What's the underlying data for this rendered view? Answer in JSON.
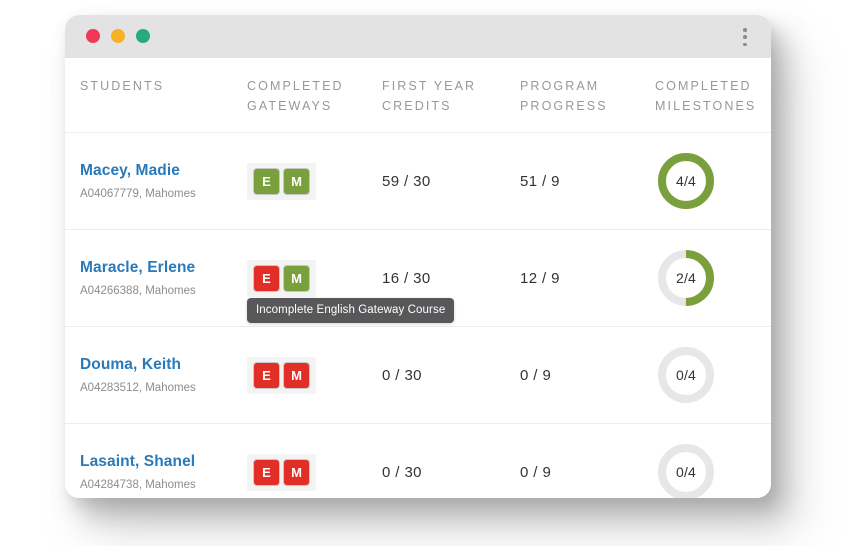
{
  "window": {
    "traffic_lights": [
      {
        "name": "close",
        "color": "#ee3a58"
      },
      {
        "name": "minimize",
        "color": "#f6b124"
      },
      {
        "name": "maximize",
        "color": "#27ab7e"
      }
    ],
    "menu_icon": "kebab-menu-icon"
  },
  "table": {
    "headers": {
      "students": "STUDENTS",
      "gateways": "COMPLETED\nGATEWAYS",
      "credits": "FIRST YEAR\nCREDITS",
      "progress": "PROGRAM\nPROGRESS",
      "milestones": "COMPLETED\nMILESTONES"
    },
    "rows": [
      {
        "name": "Macey, Madie",
        "meta": "A04067779, Mahomes",
        "gateways": [
          {
            "letter": "E",
            "status": "complete"
          },
          {
            "letter": "M",
            "status": "complete"
          }
        ],
        "credits": "59 / 30",
        "progress": "51 / 9",
        "milestones_label": "4/4",
        "milestones_done": 4,
        "milestones_total": 4
      },
      {
        "name": "Maracle, Erlene",
        "meta": "A04266388, Mahomes",
        "gateways": [
          {
            "letter": "E",
            "status": "incomplete"
          },
          {
            "letter": "M",
            "status": "complete"
          }
        ],
        "credits": "16 / 30",
        "progress": "12 / 9",
        "milestones_label": "2/4",
        "milestones_done": 2,
        "milestones_total": 4,
        "tooltip": "Incomplete English Gateway Course"
      },
      {
        "name": "Douma, Keith",
        "meta": "A04283512, Mahomes",
        "gateways": [
          {
            "letter": "E",
            "status": "incomplete"
          },
          {
            "letter": "M",
            "status": "incomplete"
          }
        ],
        "credits": "0 / 30",
        "progress": "0 / 9",
        "milestones_label": "0/4",
        "milestones_done": 0,
        "milestones_total": 4
      },
      {
        "name": "Lasaint, Shanel",
        "meta": "A04284738, Mahomes",
        "gateways": [
          {
            "letter": "E",
            "status": "incomplete"
          },
          {
            "letter": "M",
            "status": "incomplete"
          }
        ],
        "credits": "0 / 30",
        "progress": "0 / 9",
        "milestones_label": "0/4",
        "milestones_done": 0,
        "milestones_total": 4
      }
    ]
  },
  "colors": {
    "complete": "#79a03c",
    "incomplete": "#e12e26",
    "ring_track": "#e7e7e7",
    "ring_fill": "#79a03c",
    "name_link": "#2a79b8",
    "header_text": "#9d9791",
    "tooltip_bg": "#58585a"
  }
}
